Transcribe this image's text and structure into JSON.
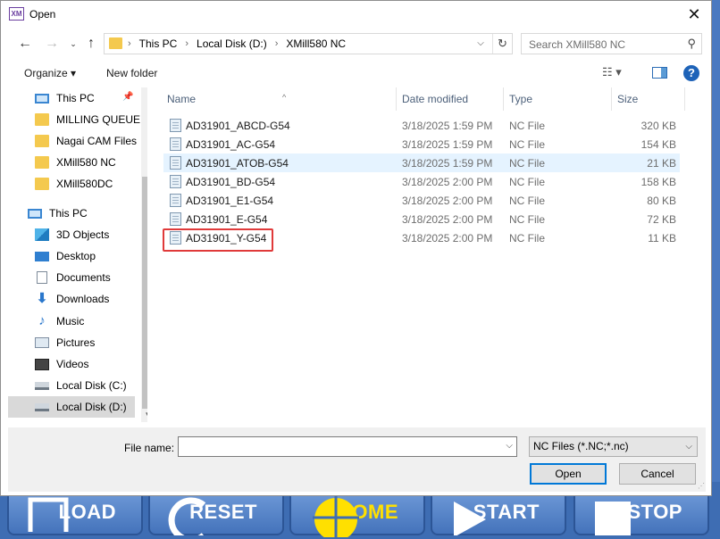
{
  "dialog": {
    "title": "Open",
    "app_icon": "XM"
  },
  "address": {
    "crumbs": [
      "This PC",
      "Local Disk (D:)",
      "XMill580 NC"
    ]
  },
  "search": {
    "placeholder": "Search XMill580 NC"
  },
  "toolbar": {
    "organize": "Organize ▾",
    "new_folder": "New folder"
  },
  "nav": {
    "items": [
      {
        "label": "This PC",
        "icon": "pc-icon",
        "top": 0,
        "indent": 30,
        "pinned": true
      },
      {
        "label": "MILLING QUEUE",
        "icon": "folder-icon",
        "indent": 30
      },
      {
        "label": "Nagai CAM Files",
        "icon": "folder-icon",
        "indent": 30
      },
      {
        "label": "XMill580 NC",
        "icon": "folder-icon",
        "indent": 30
      },
      {
        "label": "XMill580DC",
        "icon": "folder-icon",
        "indent": 30
      },
      {
        "label": "This PC",
        "icon": "pc-icon",
        "indent": 22
      },
      {
        "label": "3D Objects",
        "icon": "3d-objects-icon",
        "indent": 30
      },
      {
        "label": "Desktop",
        "icon": "desktop-icon",
        "indent": 30
      },
      {
        "label": "Documents",
        "icon": "documents-icon",
        "indent": 30
      },
      {
        "label": "Downloads",
        "icon": "downloads-icon",
        "indent": 30
      },
      {
        "label": "Music",
        "icon": "music-icon",
        "indent": 30
      },
      {
        "label": "Pictures",
        "icon": "pictures-icon",
        "indent": 30
      },
      {
        "label": "Videos",
        "icon": "videos-icon",
        "indent": 30
      },
      {
        "label": "Local Disk (C:)",
        "icon": "drive-icon",
        "indent": 30
      },
      {
        "label": "Local Disk (D:)",
        "icon": "drive-icon",
        "indent": 30,
        "selected": true
      }
    ]
  },
  "columns": {
    "name": "Name",
    "date": "Date modified",
    "type": "Type",
    "size": "Size"
  },
  "files": [
    {
      "name": "AD31901_ABCD-G54",
      "date": "3/18/2025 1:59 PM",
      "type": "NC File",
      "size": "320 KB"
    },
    {
      "name": "AD31901_AC-G54",
      "date": "3/18/2025 1:59 PM",
      "type": "NC File",
      "size": "154 KB"
    },
    {
      "name": "AD31901_ATOB-G54",
      "date": "3/18/2025 1:59 PM",
      "type": "NC File",
      "size": "21 KB",
      "hover": true
    },
    {
      "name": "AD31901_BD-G54",
      "date": "3/18/2025 2:00 PM",
      "type": "NC File",
      "size": "158 KB"
    },
    {
      "name": "AD31901_E1-G54",
      "date": "3/18/2025 2:00 PM",
      "type": "NC File",
      "size": "80 KB"
    },
    {
      "name": "AD31901_E-G54",
      "date": "3/18/2025 2:00 PM",
      "type": "NC File",
      "size": "72 KB"
    },
    {
      "name": "AD31901_Y-G54",
      "date": "3/18/2025 2:00 PM",
      "type": "NC File",
      "size": "11 KB",
      "annotated": true
    }
  ],
  "bottom": {
    "file_name_label": "File name:",
    "file_name_value": "",
    "filter": "NC Files (*.NC;*.nc)",
    "open": "Open",
    "cancel": "Cancel"
  },
  "background_buttons": [
    "LOAD",
    "RESET",
    "HOME",
    "START",
    "STOP"
  ],
  "colors": {
    "accent": "#0078d7",
    "annotation": "#e03a3a",
    "app_bg": "#4a79c0"
  }
}
